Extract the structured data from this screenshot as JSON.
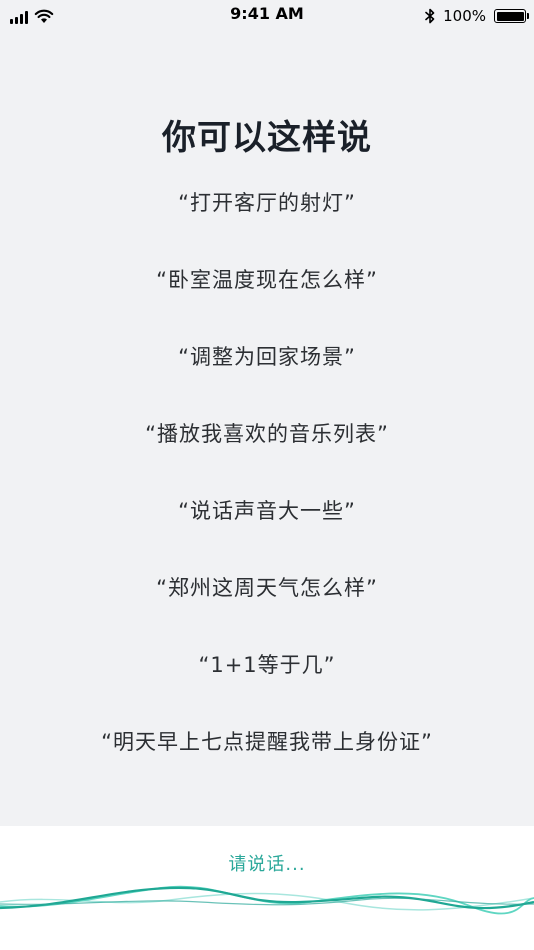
{
  "status_bar": {
    "time": "9:41 AM",
    "battery_percent": "100%",
    "icons": [
      "signal-icon",
      "wifi-icon",
      "bluetooth-icon",
      "battery-icon"
    ]
  },
  "title": "你可以这样说",
  "suggestions": [
    "“打开客厅的射灯”",
    "“卧室温度现在怎么样”",
    "“调整为回家场景”",
    "“播放我喜欢的音乐列表”",
    "“说话声音大一些”",
    "“郑州这周天气怎么样”",
    "“1+1等于几”",
    "“明天早上七点提醒我带上身份证”"
  ],
  "voice_panel": {
    "prompt": "请说话...",
    "wave_colors": [
      "#1fa894",
      "#5fd6c2",
      "#a8e6de"
    ]
  }
}
